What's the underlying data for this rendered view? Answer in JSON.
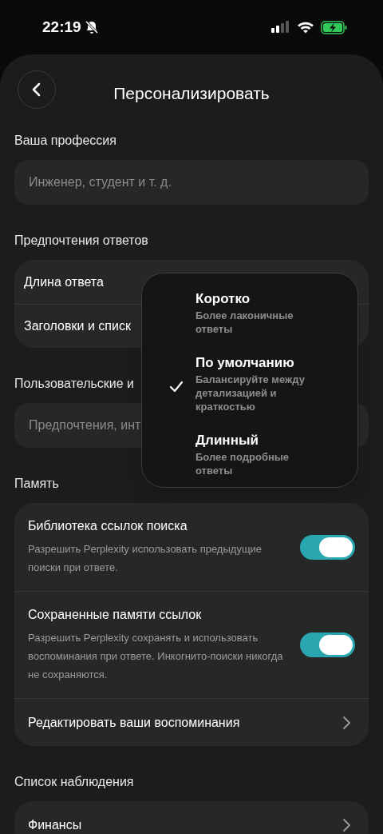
{
  "status_bar": {
    "time": "22:19"
  },
  "header": {
    "title": "Персонализировать"
  },
  "sections": [
    {
      "kind": "field",
      "title": "Ваша профессия",
      "placeholder": "Инженер, студент и т. д."
    },
    {
      "kind": "list",
      "title": "Предпочтения ответов",
      "rows": [
        {
          "kind": "plain",
          "label": "Длина ответа"
        },
        {
          "kind": "plain",
          "label": "Заголовки и списк"
        }
      ]
    },
    {
      "kind": "field",
      "title": "Пользовательские и",
      "placeholder": "Предпочтения, инт"
    },
    {
      "kind": "list",
      "title": "Память",
      "rows": [
        {
          "kind": "toggle",
          "label": "Библиотека ссылок поиска",
          "description": "Разрешить Perplexity использовать предыдущие поиски при ответе.",
          "on": true
        },
        {
          "kind": "toggle",
          "label": "Сохраненные памяти ссылок",
          "description": "Разрешить Perplexity сохранять и использовать воспоминания при ответе. Инкогнито-поиски никогда не сохраняются.",
          "on": true
        },
        {
          "kind": "link",
          "label": "Редактировать ваши воспоминания"
        }
      ]
    },
    {
      "kind": "list",
      "title": "Список наблюдения",
      "rows": [
        {
          "kind": "link",
          "label": "Финансы"
        }
      ]
    }
  ],
  "dropdown": {
    "options": [
      {
        "title": "Коротко",
        "description": "Более лаконичные ответы",
        "selected": false
      },
      {
        "title": "По умолчанию",
        "description": "Балансируйте между детализацией и краткостью",
        "selected": true
      },
      {
        "title": "Длинный",
        "description": "Более подробные ответы",
        "selected": false
      }
    ]
  }
}
